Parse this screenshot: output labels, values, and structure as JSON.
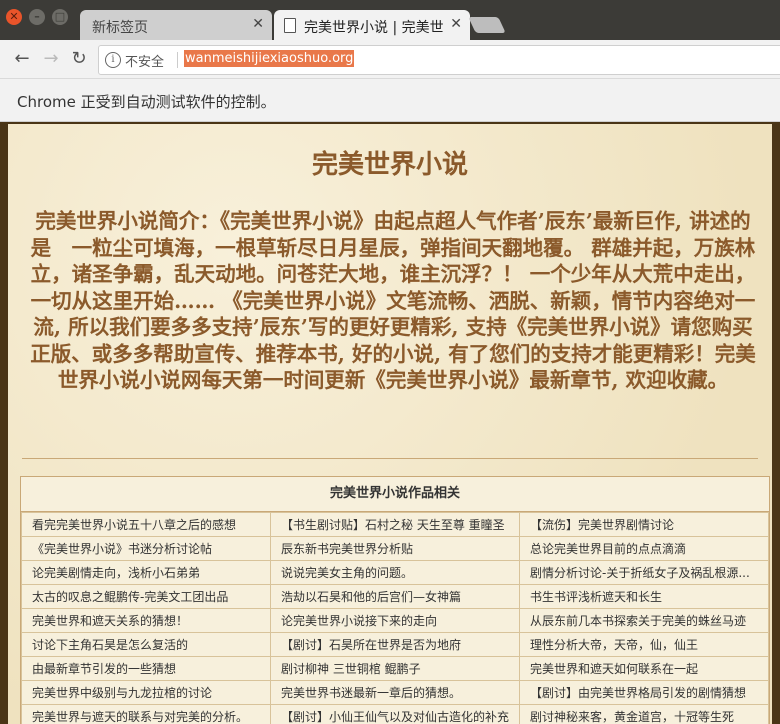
{
  "browser": {
    "tabs": [
      {
        "title": "新标签页",
        "active": false
      },
      {
        "title": "完美世界小说 | 完美世界小说",
        "active": true
      }
    ],
    "omnibox": {
      "security_label": "不安全",
      "url": "wanmeishijiexiaoshuo.org"
    },
    "infobar_message": "Chrome 正受到自动测试软件的控制。"
  },
  "page": {
    "heading": "完美世界小说",
    "intro": "完美世界小说简介：《完美世界小说》由起点超人气作者’辰东’最新巨作, 讲述的是　一粒尘可填海，一根草斩尽日月星辰，弹指间天翻地覆。 群雄并起，万族林立，诸圣争霸，乱天动地。问苍茫大地，谁主沉浮？！ 一个少年从大荒中走出，一切从这里开始…… 《完美世界小说》文笔流畅、洒脱、新颖，情节内容绝对一流, 所以我们要多多支持’辰东’写的更好更精彩, 支持《完美世界小说》请您购买正版、或多多帮助宣传、推荐本书, 好的小说, 有了您们的支持才能更精彩！完美世界小说小说网每天第一时间更新《完美世界小说》最新章节, 欢迎收藏。",
    "related": {
      "title": "完美世界小说作品相关",
      "rows": [
        [
          "看完完美世界小说五十八章之后的感想",
          "【书生剧讨贴】石村之秘 天生至尊 重瞳圣",
          "【流伤】完美世界剧情讨论"
        ],
        [
          "《完美世界小说》书迷分析讨论帖",
          "辰东新书完美世界分析贴",
          "总论完美世界目前的点点滴滴"
        ],
        [
          "论完美剧情走向，浅析小石弟弟",
          "说说完美女主角的问题。",
          "剧情分析讨论-关于折纸女子及祸乱根源..."
        ],
        [
          "太古的叹息之鲲鹏传-完美文工团出品",
          "浩劫以石昊和他的后宫们—女神篇",
          "书生书评浅析遮天和长生"
        ],
        [
          "完美世界和遮天关系的猜想！",
          "论完美世界小说接下来的走向",
          "从辰东前几本书探索关于完美的蛛丝马迹"
        ],
        [
          "讨论下主角石昊是怎么复活的",
          "【剧讨】石昊所在世界是否为地府",
          "理性分析大帝，天帝，仙，仙王"
        ],
        [
          "由最新章节引发的一些猜想",
          "剧讨柳神 三世铜棺 鲲鹏子",
          "完美世界和遮天如何联系在一起"
        ],
        [
          "完美世界中级别与九龙拉棺的讨论",
          "完美世界书迷最新一章后的猜想。",
          "【剧讨】由完美世界格局引发的剧情猜想"
        ],
        [
          "完美世界与遮天的联系与对完美的分析。",
          "【剧讨】小仙王仙气以及对仙古造化的补充",
          "剧讨神秘来客，黄金道宫，十冠等生死"
        ]
      ]
    }
  }
}
